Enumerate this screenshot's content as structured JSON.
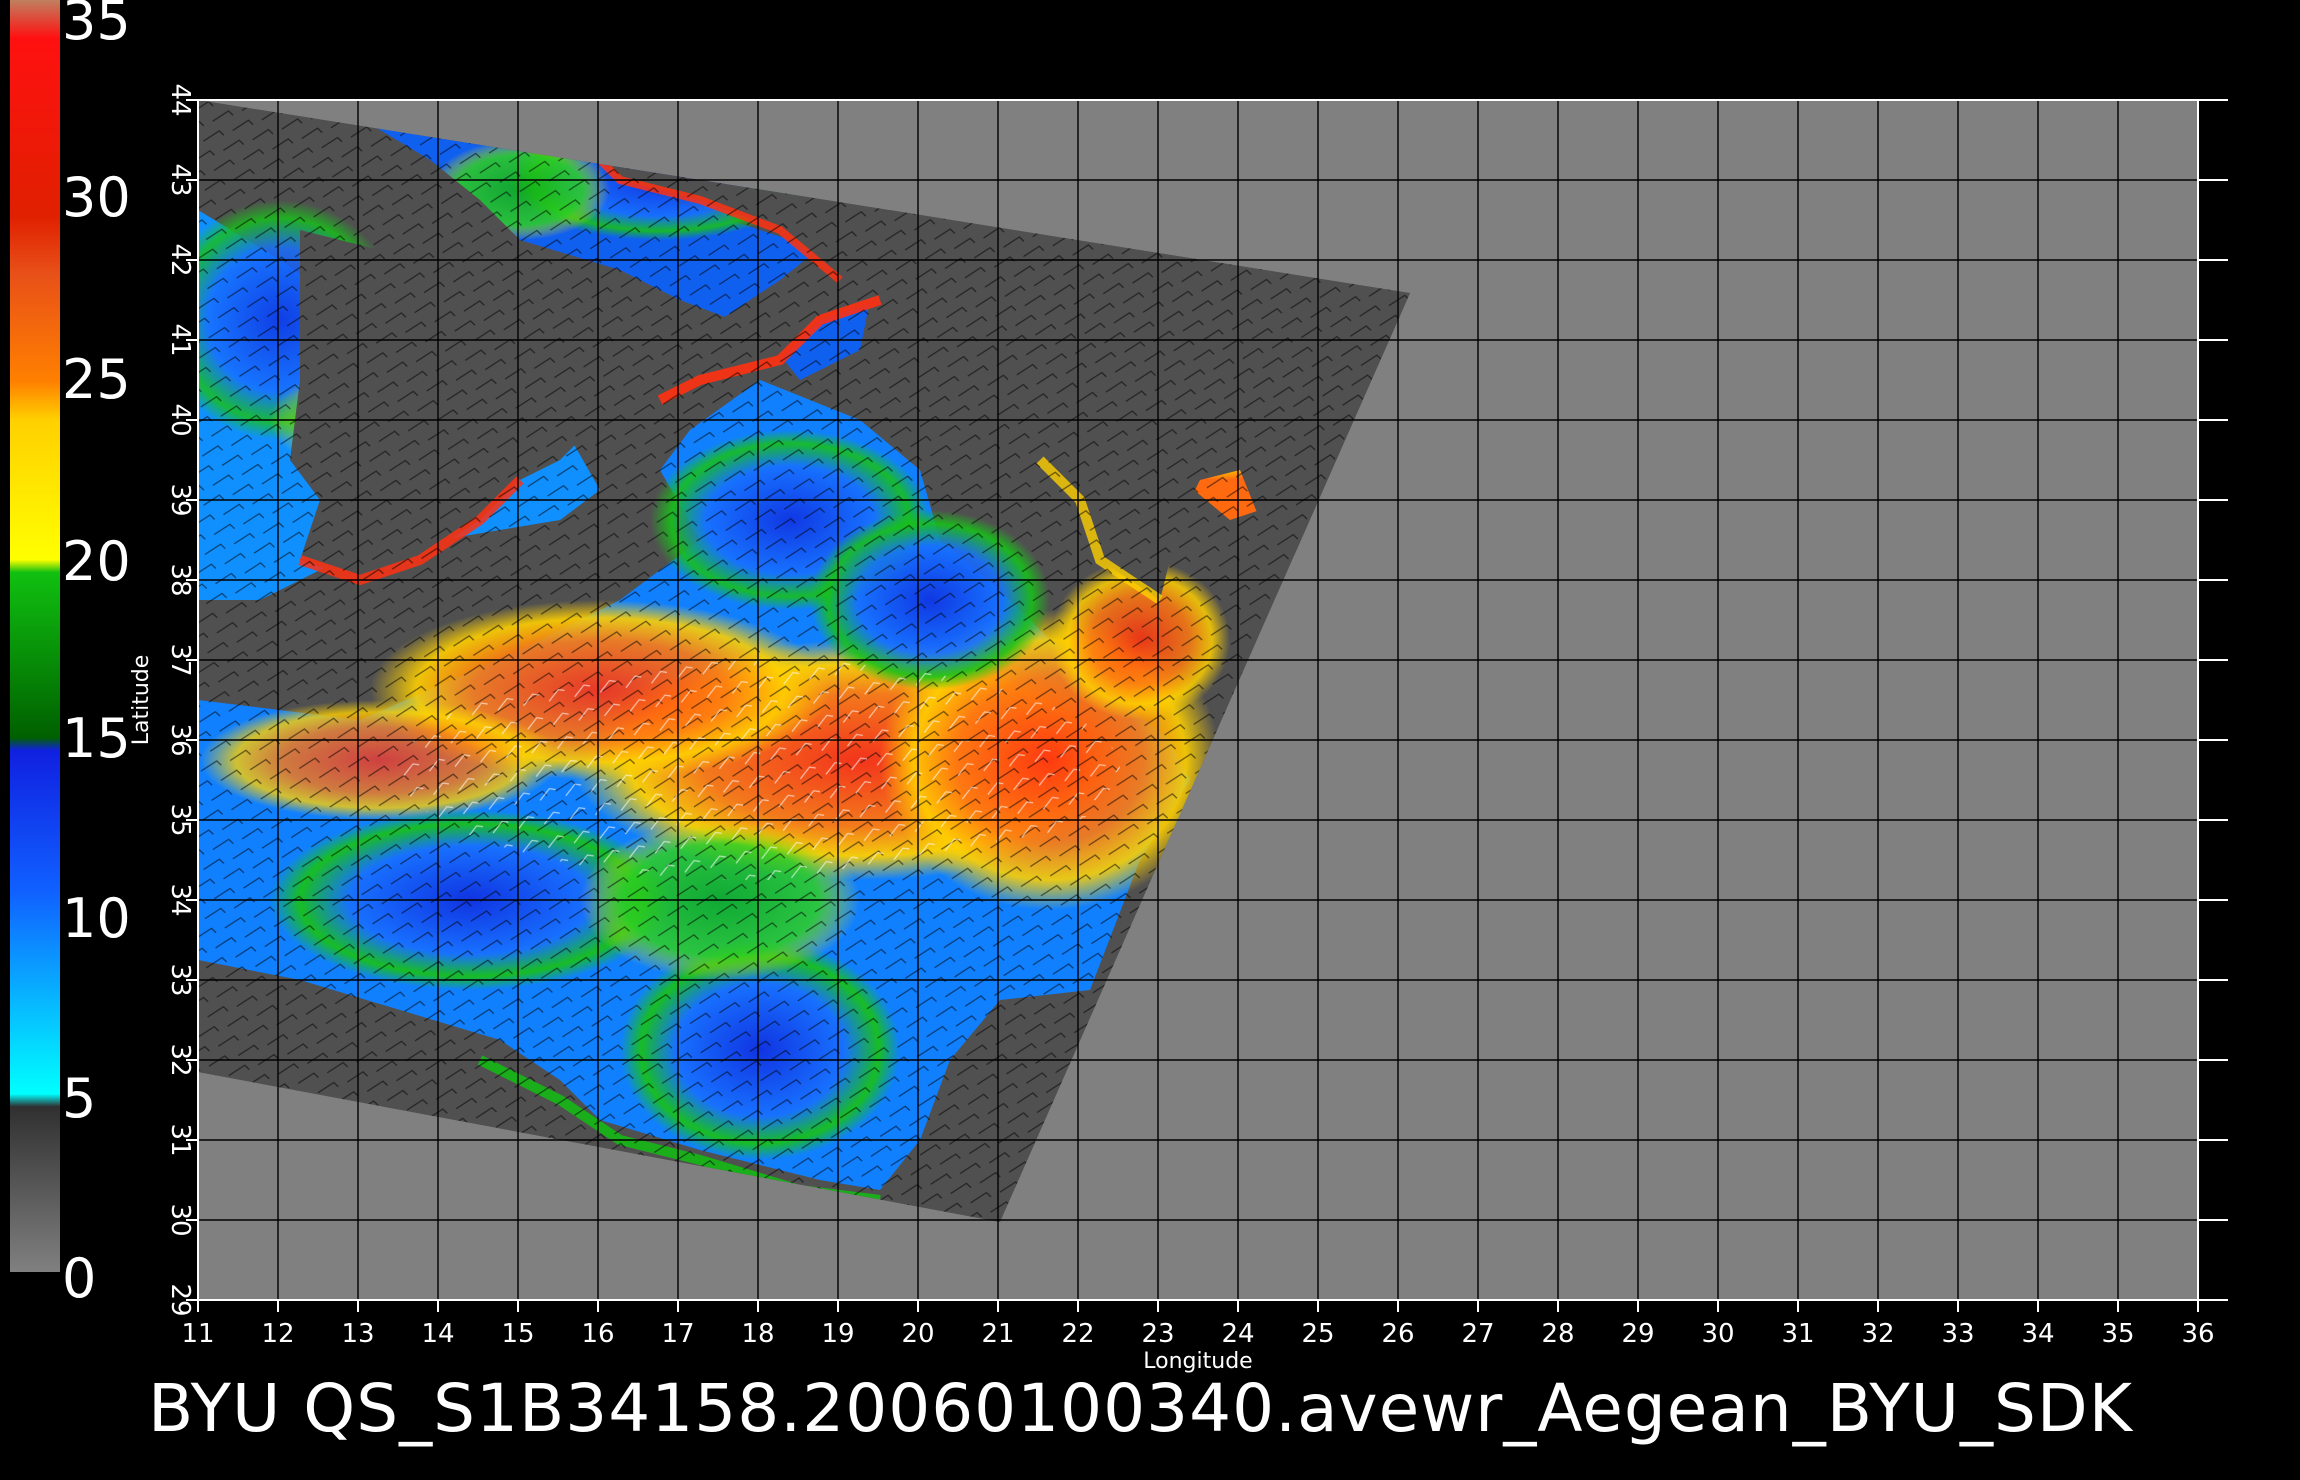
{
  "title": "BYU  QS_S1B34158.20060100340.avewr_Aegean_BYU_SDK",
  "colorbar": {
    "labels": [
      "35",
      "30",
      "25",
      "20",
      "15",
      "10",
      "5",
      "0"
    ],
    "colors": {
      "band_30_35": "#ff2a10",
      "band_25_30": "#e8501a",
      "band_20_25": "#ffd800",
      "band_15_20": "#10b810",
      "band_10_15": "#1040f0",
      "band_5_10": "#20a0ff",
      "band_0_5": "#505050"
    }
  },
  "map": {
    "x_axis_label": "Longitude",
    "y_axis_label": "Latitude",
    "x_ticks": [
      "11",
      "12",
      "13",
      "14",
      "15",
      "16",
      "17",
      "18",
      "19",
      "20",
      "21",
      "22",
      "23",
      "24",
      "25",
      "26",
      "27",
      "28",
      "29",
      "30",
      "31",
      "32",
      "33",
      "34",
      "35",
      "36"
    ],
    "y_ticks": [
      "29",
      "30",
      "31",
      "32",
      "33",
      "34",
      "35",
      "36",
      "37",
      "38",
      "39",
      "40",
      "41",
      "42",
      "43",
      "44"
    ],
    "lon_range": [
      11,
      36
    ],
    "lat_range": [
      29,
      44
    ],
    "background_color": "#808080",
    "swath_color": "#505050",
    "grid": true
  }
}
